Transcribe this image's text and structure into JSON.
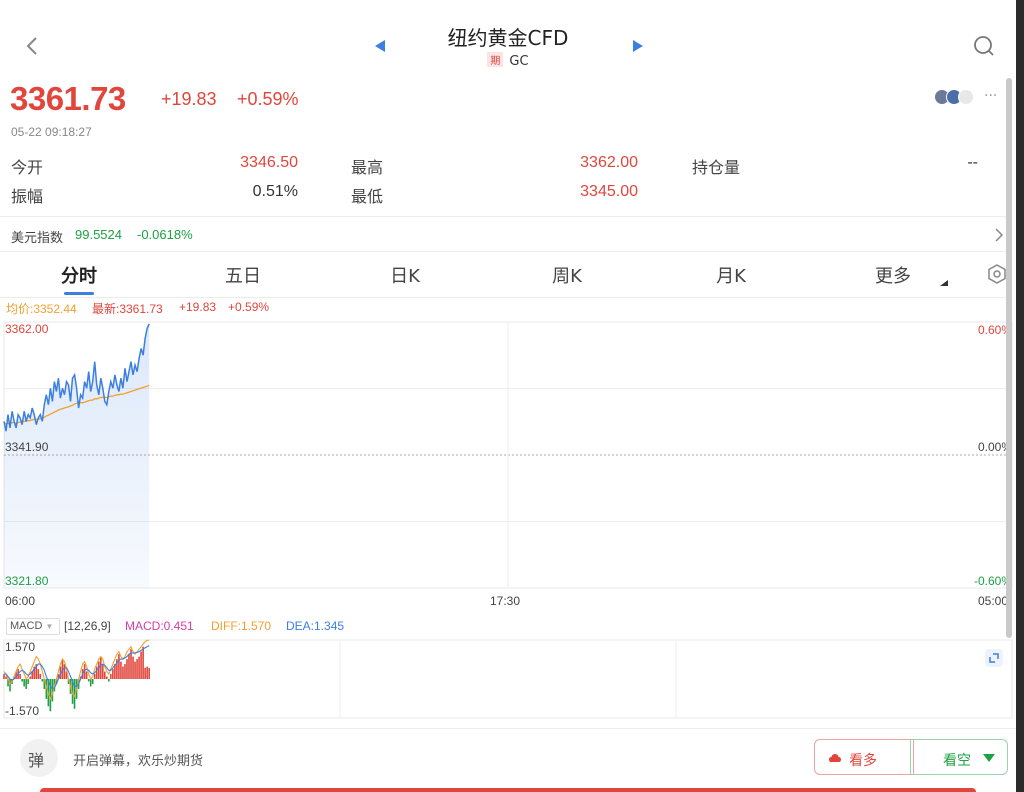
{
  "header": {
    "title": "纽约黄金CFD",
    "badge": "期",
    "code": "GC"
  },
  "quote": {
    "price": "3361.73",
    "change": "+19.83",
    "change_pct": "+0.59%",
    "timestamp": "05-22 09:18:27",
    "more": "···"
  },
  "stats": {
    "open_label": "今开",
    "open_value": "3346.50",
    "high_label": "最高",
    "high_value": "3362.00",
    "oi_label": "持仓量",
    "oi_value": "--",
    "amp_label": "振幅",
    "amp_value": "0.51%",
    "low_label": "最低",
    "low_value": "3345.00"
  },
  "usd_index": {
    "label": "美元指数",
    "value": "99.5524",
    "change": "-0.0618%"
  },
  "tabs": [
    "分时",
    "五日",
    "日K",
    "周K",
    "月K",
    "更多"
  ],
  "chart_legend": {
    "avg": "均价:3352.44",
    "latest": "最新:3361.73",
    "change": "+19.83",
    "pct": "+0.59%"
  },
  "chart_data": {
    "type": "line",
    "title": "",
    "ylim": [
      3321.8,
      3362.0
    ],
    "y_ticks_left": [
      "3362.00",
      "3341.90",
      "3321.80"
    ],
    "y_ticks_right": [
      "0.60%",
      "0.00%",
      "-0.60%"
    ],
    "x_ticks": [
      "06:00",
      "17:30",
      "05:00"
    ],
    "x": [
      0,
      1,
      2,
      3,
      4,
      5,
      6,
      7,
      8,
      9,
      10,
      11,
      12,
      13,
      14,
      15,
      16,
      17,
      18,
      19,
      20,
      21,
      22,
      23,
      24,
      25,
      26,
      27,
      28,
      29,
      30,
      31,
      32,
      33,
      34,
      35,
      36,
      37,
      38,
      39,
      40,
      41,
      42,
      43,
      44,
      45,
      46,
      47,
      48,
      49,
      50,
      51,
      52,
      53,
      54,
      55,
      56,
      57,
      58,
      59,
      60,
      61,
      62,
      63,
      64,
      65,
      66,
      67,
      68,
      69,
      70,
      71,
      72
    ],
    "x_total": 500,
    "series": [
      {
        "name": "最新",
        "color": "#3d7fe0",
        "values": [
          3347.0,
          3345.5,
          3348.0,
          3346.0,
          3348.5,
          3347.0,
          3346.0,
          3348.0,
          3347.5,
          3346.5,
          3348.5,
          3347.0,
          3348.0,
          3347.5,
          3349.0,
          3348.0,
          3346.5,
          3347.5,
          3348.0,
          3347.0,
          3349.5,
          3351.0,
          3349.5,
          3352.0,
          3350.0,
          3353.0,
          3351.5,
          3353.5,
          3350.5,
          3352.0,
          3351.0,
          3353.0,
          3352.5,
          3350.0,
          3353.5,
          3354.0,
          3352.0,
          3349.0,
          3351.0,
          3350.5,
          3353.0,
          3352.0,
          3354.5,
          3351.5,
          3353.0,
          3356.0,
          3352.5,
          3351.0,
          3353.5,
          3352.0,
          3350.0,
          3349.5,
          3351.5,
          3353.0,
          3352.0,
          3354.0,
          3352.5,
          3351.5,
          3353.5,
          3352.0,
          3355.0,
          3353.0,
          3354.5,
          3356.0,
          3354.0,
          3355.5,
          3354.5,
          3356.5,
          3358.0,
          3357.0,
          3359.5,
          3361.0,
          3361.73
        ]
      },
      {
        "name": "均价",
        "color": "#f0a030",
        "values": [
          3346.8,
          3346.6,
          3346.7,
          3346.6,
          3346.8,
          3346.8,
          3346.7,
          3346.8,
          3346.9,
          3346.9,
          3347.0,
          3347.0,
          3347.1,
          3347.1,
          3347.2,
          3347.3,
          3347.3,
          3347.3,
          3347.4,
          3347.4,
          3347.6,
          3347.8,
          3347.9,
          3348.1,
          3348.2,
          3348.4,
          3348.5,
          3348.7,
          3348.8,
          3348.9,
          3349.0,
          3349.1,
          3349.2,
          3349.3,
          3349.4,
          3349.6,
          3349.7,
          3349.7,
          3349.8,
          3349.8,
          3349.9,
          3350.0,
          3350.1,
          3350.2,
          3350.2,
          3350.4,
          3350.4,
          3350.5,
          3350.6,
          3350.6,
          3350.6,
          3350.6,
          3350.7,
          3350.8,
          3350.8,
          3350.9,
          3351.0,
          3351.0,
          3351.1,
          3351.1,
          3351.2,
          3351.3,
          3351.4,
          3351.5,
          3351.6,
          3351.7,
          3351.8,
          3351.9,
          3352.0,
          3352.1,
          3352.2,
          3352.3,
          3352.44
        ]
      }
    ]
  },
  "macd": {
    "selector": "MACD",
    "params": "[12,26,9]",
    "macd": "MACD:0.451",
    "diff": "DIFF:1.570",
    "dea": "DEA:1.345",
    "y_top": "1.570",
    "y_bottom": "-1.570",
    "ylim": [
      -1.57,
      1.57
    ],
    "histogram": [
      0.2,
      0.1,
      -0.3,
      -0.5,
      -0.2,
      0.1,
      0.3,
      0.4,
      0.2,
      -0.1,
      -0.3,
      -0.4,
      -0.2,
      0.1,
      0.3,
      0.5,
      0.6,
      0.4,
      0.2,
      -0.1,
      -0.4,
      -0.8,
      -1.1,
      -1.3,
      -0.9,
      -0.5,
      -0.2,
      0.2,
      0.5,
      0.8,
      0.6,
      0.3,
      -0.2,
      -0.6,
      -1.0,
      -1.2,
      -0.8,
      -0.4,
      0.1,
      0.4,
      0.6,
      0.3,
      -0.1,
      -0.3,
      -0.2,
      0.2,
      0.5,
      0.7,
      0.9,
      0.6,
      0.3,
      0.1,
      -0.1,
      0.2,
      0.4,
      0.6,
      0.8,
      1.0,
      0.7,
      0.5,
      0.6,
      0.8,
      1.0,
      1.2,
      0.9,
      0.7,
      0.8,
      0.9,
      1.1,
      1.3,
      0.45,
      0.5,
      0.45
    ],
    "diff_line": [
      0.3,
      0.2,
      0.0,
      -0.2,
      -0.1,
      0.1,
      0.3,
      0.5,
      0.6,
      0.4,
      0.2,
      0.0,
      0.1,
      0.3,
      0.5,
      0.7,
      0.9,
      0.8,
      0.6,
      0.3,
      0.0,
      -0.3,
      -0.6,
      -0.8,
      -0.6,
      -0.3,
      0.0,
      0.3,
      0.6,
      0.8,
      0.7,
      0.4,
      0.0,
      -0.3,
      -0.6,
      -0.7,
      -0.4,
      0.0,
      0.3,
      0.6,
      0.7,
      0.5,
      0.2,
      0.0,
      0.1,
      0.4,
      0.6,
      0.8,
      0.9,
      0.8,
      0.5,
      0.3,
      0.2,
      0.4,
      0.6,
      0.8,
      1.0,
      1.1,
      0.9,
      0.8,
      0.9,
      1.1,
      1.2,
      1.3,
      1.1,
      1.0,
      1.1,
      1.2,
      1.3,
      1.4,
      1.5,
      1.55,
      1.57
    ],
    "dea_line": [
      0.2,
      0.2,
      0.1,
      0.0,
      -0.05,
      0.0,
      0.1,
      0.2,
      0.3,
      0.35,
      0.3,
      0.2,
      0.15,
      0.2,
      0.3,
      0.4,
      0.5,
      0.6,
      0.6,
      0.5,
      0.35,
      0.1,
      -0.1,
      -0.3,
      -0.4,
      -0.35,
      -0.2,
      0.0,
      0.2,
      0.35,
      0.45,
      0.45,
      0.3,
      0.1,
      -0.1,
      -0.3,
      -0.3,
      -0.2,
      0.0,
      0.2,
      0.35,
      0.4,
      0.35,
      0.25,
      0.2,
      0.25,
      0.35,
      0.45,
      0.55,
      0.6,
      0.55,
      0.45,
      0.35,
      0.35,
      0.45,
      0.55,
      0.65,
      0.75,
      0.8,
      0.8,
      0.85,
      0.9,
      1.0,
      1.05,
      1.05,
      1.05,
      1.07,
      1.1,
      1.15,
      1.2,
      1.26,
      1.3,
      1.345
    ]
  },
  "bottom": {
    "danmu_icon": "弹",
    "danmu_text": "开启弹幕，欢乐炒期货",
    "long_label": "看多",
    "short_label": "看空"
  },
  "colors": {
    "up": "#e0463c",
    "down": "#1ea142",
    "accent": "#3d7fe0",
    "avg": "#f0a030"
  }
}
